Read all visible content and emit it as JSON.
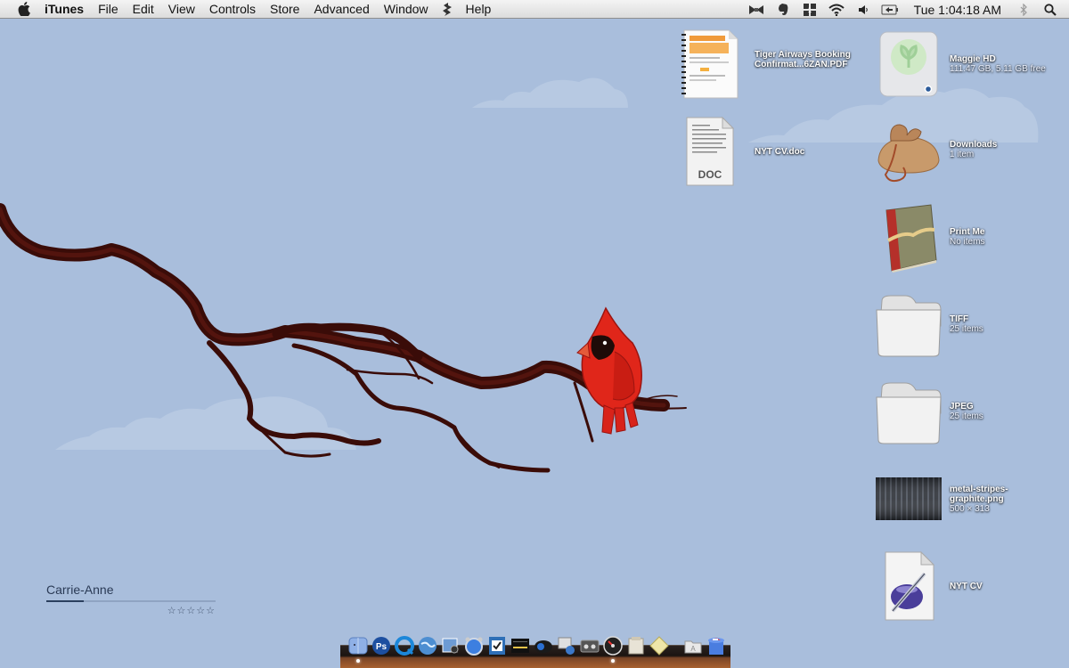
{
  "menubar": {
    "app_name": "iTunes",
    "menus": [
      "File",
      "Edit",
      "View",
      "Controls",
      "Store",
      "Advanced",
      "Window",
      "Help"
    ],
    "status_icons": [
      "bowtie-icon",
      "evernote-icon",
      "spaces-icon",
      "wifi-icon",
      "volume-icon",
      "battery-icon"
    ],
    "clock": "Tue 1:04:18 AM"
  },
  "desktop": {
    "icons": [
      {
        "name": "Tiger Airways Booking Confirmat...6ZAN.PDF",
        "line1": "Tiger Airways Booking",
        "line2": "Confirmat...6ZAN.PDF",
        "sub": "",
        "kind": "pdf"
      },
      {
        "name": "NYT CV.doc",
        "line1": "NYT CV.doc",
        "line2": "",
        "sub": "",
        "kind": "doc",
        "badge": "DOC"
      },
      {
        "name": "Maggie HD",
        "line1": "Maggie HD",
        "line2": "",
        "sub": "111.47 GB, 5.11 GB free",
        "kind": "drive"
      },
      {
        "name": "Downloads",
        "line1": "Downloads",
        "line2": "",
        "sub": "1 item",
        "kind": "sack"
      },
      {
        "name": "Print Me",
        "line1": "Print Me",
        "line2": "",
        "sub": "No items",
        "kind": "book"
      },
      {
        "name": "TIFF",
        "line1": "TIFF",
        "line2": "",
        "sub": "25 items",
        "kind": "folder"
      },
      {
        "name": "JPEG",
        "line1": "JPEG",
        "line2": "",
        "sub": "25 items",
        "kind": "folder"
      },
      {
        "name": "metal-stripes-graphite.png",
        "line1": "metal-stripes-",
        "line2": "graphite.png",
        "sub": "500 × 313",
        "kind": "image"
      },
      {
        "name": "NYT CV",
        "line1": "NYT CV",
        "line2": "",
        "sub": "",
        "kind": "pages"
      }
    ]
  },
  "itunes_widget": {
    "track": "Carrie-Anne",
    "progress": 0.22,
    "rating": "☆☆☆☆☆",
    "rating_value": 0
  },
  "dock": {
    "items": [
      {
        "name": "finder",
        "running": true
      },
      {
        "name": "photoshop",
        "running": false
      },
      {
        "name": "quicktime",
        "running": false
      },
      {
        "name": "earth-browser",
        "running": false
      },
      {
        "name": "preview",
        "running": false
      },
      {
        "name": "alarm-clock",
        "running": false
      },
      {
        "name": "tasks",
        "running": false
      },
      {
        "name": "terminal",
        "running": false
      },
      {
        "name": "camera-app",
        "running": false
      },
      {
        "name": "iphoto",
        "running": false
      },
      {
        "name": "tape-app",
        "running": false
      },
      {
        "name": "dashboard",
        "running": true
      },
      {
        "name": "paper-app",
        "running": false
      },
      {
        "name": "stickies",
        "running": false
      },
      {
        "name": "applications-folder",
        "running": false
      },
      {
        "name": "trash",
        "running": false
      }
    ]
  },
  "colors": {
    "sky": "#a9bedc",
    "cloud": "#b7c9e2",
    "branch": "#3d0f0a",
    "cardinal": "#e0261a"
  }
}
